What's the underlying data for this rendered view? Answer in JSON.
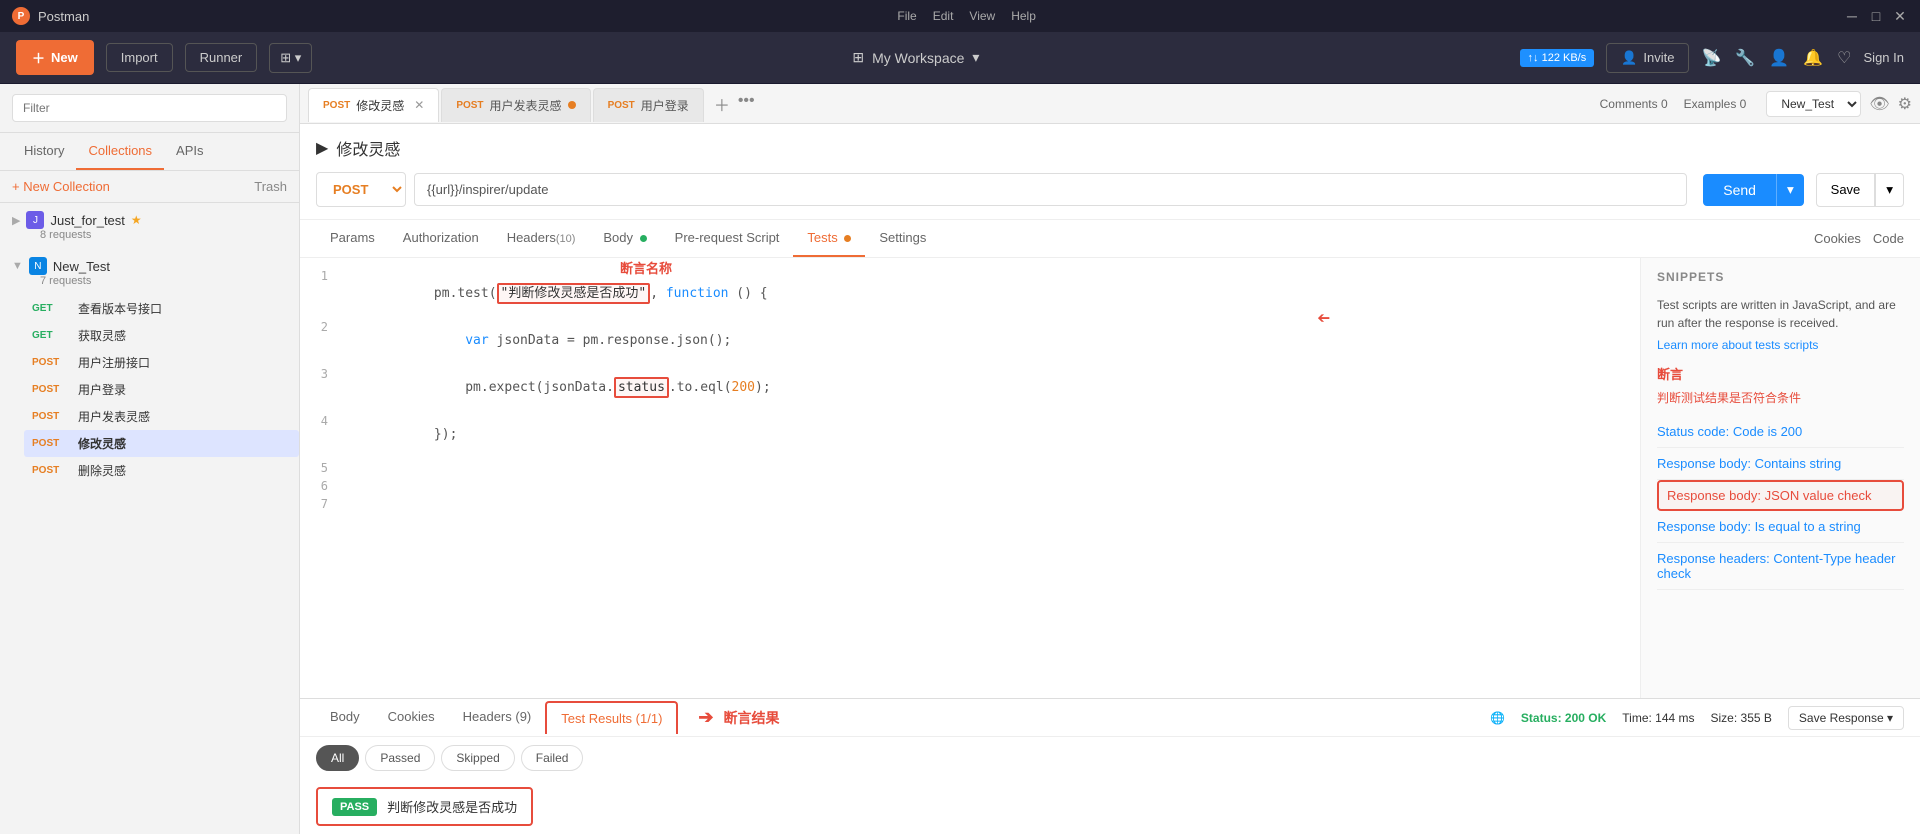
{
  "app": {
    "title": "Postman",
    "logo_text": "P",
    "menu_items": [
      "File",
      "Edit",
      "View",
      "Help"
    ],
    "window_controls": [
      "−",
      "□",
      "×"
    ]
  },
  "toolbar": {
    "new_label": "New",
    "import_label": "Import",
    "runner_label": "Runner",
    "workspace_label": "My Workspace",
    "invite_label": "Invite",
    "signin_label": "Sign In",
    "net_badge": "122 KB/s"
  },
  "sidebar": {
    "search_placeholder": "Filter",
    "tabs": [
      "History",
      "Collections",
      "APIs"
    ],
    "active_tab": "Collections",
    "new_collection_label": "+ New Collection",
    "trash_label": "Trash",
    "collections": [
      {
        "name": "Just_for_test",
        "count": "8 requests",
        "icon": "J",
        "color": "#6c5ce7",
        "starred": true,
        "expanded": false
      },
      {
        "name": "New_Test",
        "count": "7 requests",
        "icon": "N",
        "color": "#0984e3",
        "starred": false,
        "expanded": true
      }
    ],
    "requests": [
      {
        "method": "GET",
        "name": "查看版本号接口"
      },
      {
        "method": "GET",
        "name": "获取灵感"
      },
      {
        "method": "POST",
        "name": "用户注册接口"
      },
      {
        "method": "POST",
        "name": "用户登录"
      },
      {
        "method": "POST",
        "name": "用户发表灵感"
      },
      {
        "method": "POST",
        "name": "修改灵感",
        "active": true
      },
      {
        "method": "POST",
        "name": "删除灵感"
      }
    ]
  },
  "tabs": [
    {
      "method": "POST",
      "name": "修改灵感",
      "active": true,
      "closeable": true
    },
    {
      "method": "POST",
      "name": "用户发表灵感",
      "dot": true
    },
    {
      "method": "POST",
      "name": "用户登录"
    }
  ],
  "env_selector": "New_Test",
  "request": {
    "title": "修改灵感",
    "method": "POST",
    "url": "{{url}}/inspirer/update",
    "url_display": "{{url}}/inspirer/update",
    "send_label": "Send",
    "save_label": "Save"
  },
  "req_tabs": [
    {
      "label": "Params"
    },
    {
      "label": "Authorization"
    },
    {
      "label": "Headers",
      "count": "(10)"
    },
    {
      "label": "Body",
      "dot": "green"
    },
    {
      "label": "Pre-request Script"
    },
    {
      "label": "Tests",
      "dot": "orange",
      "active": true
    },
    {
      "label": "Settings"
    }
  ],
  "req_tabs_right": [
    "Cookies",
    "Code"
  ],
  "comments_label": "Comments  0",
  "examples_label": "Examples  0",
  "code_lines": [
    {
      "num": 1,
      "content": "pm.test(\"判断修改灵感是否成功\", function () {",
      "has_highlight_start": true,
      "has_highlight_end": false
    },
    {
      "num": 2,
      "content": "    var jsonData = pm.response.json();",
      "has_highlight_start": false,
      "has_highlight_end": false
    },
    {
      "num": 3,
      "content": "    pm.expect(jsonData.status).to.eql(200);",
      "has_highlight_start": false,
      "has_highlight_end": false
    },
    {
      "num": 4,
      "content": "});",
      "has_highlight_start": false,
      "has_highlight_end": true
    },
    {
      "num": 5,
      "content": ""
    },
    {
      "num": 6,
      "content": ""
    },
    {
      "num": 7,
      "content": ""
    }
  ],
  "annotations": {
    "label_name": "断言名称",
    "label_snippet": "断言",
    "label_condition": "判断测试结果是否符合条件",
    "label_result": "断言结果"
  },
  "snippets": {
    "title": "SNIPPETS",
    "description": "Test scripts are written in JavaScript, and are run after the response is received.",
    "link": "Learn more about tests scripts",
    "items": [
      "Status code: Code is 200",
      "Response body: Contains string",
      "Response body: JSON value check",
      "Response body: Is equal to a string",
      "Response headers: Content-Type header check"
    ],
    "highlighted_index": 2
  },
  "response": {
    "tabs": [
      "Body",
      "Cookies",
      "Headers (9)",
      "Test Results (1/1)"
    ],
    "active_tab": "Test Results (1/1)",
    "status": "Status: 200 OK",
    "time": "Time: 144 ms",
    "size": "Size: 355 B",
    "save_response_label": "Save Response"
  },
  "test_filters": [
    "All",
    "Passed",
    "Skipped",
    "Failed"
  ],
  "active_filter": "All",
  "test_results": [
    {
      "status": "PASS",
      "name": "判断修改灵感是否成功"
    }
  ]
}
